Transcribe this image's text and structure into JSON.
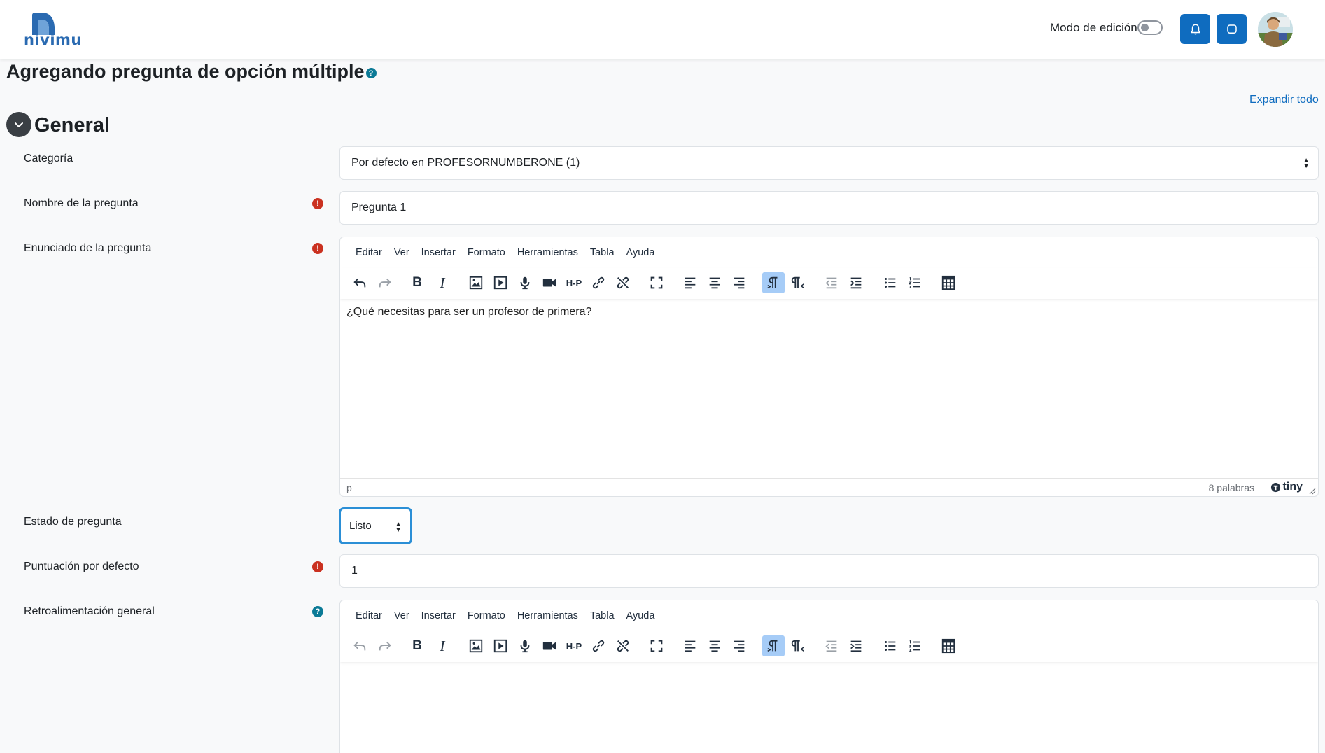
{
  "brand": {
    "name": "nivimu",
    "color": "#2a6ab1"
  },
  "navbar": {
    "edit_mode_label": "Modo de edición",
    "edit_mode_on": false,
    "buttons": [
      "bell-icon",
      "message-icon"
    ],
    "accent": "#0f6cbf"
  },
  "page": {
    "title": "Agregando pregunta de opción múltiple",
    "expand_all": "Expandir todo",
    "section_title": "General"
  },
  "form": {
    "category_label": "Categoría",
    "category_value": "Por defecto en PROFESORNUMBERONE (1)",
    "name_label": "Nombre de la pregunta",
    "name_value": "Pregunta 1",
    "statement_label": "Enunciado de la pregunta",
    "statement_text": "¿Qué necesitas para ser un profesor de primera?",
    "status_label": "Estado de pregunta",
    "status_value": "Listo",
    "score_label": "Puntuación por defecto",
    "score_value": "1",
    "feedback_label": "Retroalimentación general",
    "required_icon": "!",
    "help_icon": "?"
  },
  "editor": {
    "menu": [
      "Editar",
      "Ver",
      "Insertar",
      "Formato",
      "Herramientas",
      "Tabla",
      "Ayuda"
    ],
    "status_path": "p",
    "word_count": "8 palabras",
    "brand": "tiny"
  }
}
